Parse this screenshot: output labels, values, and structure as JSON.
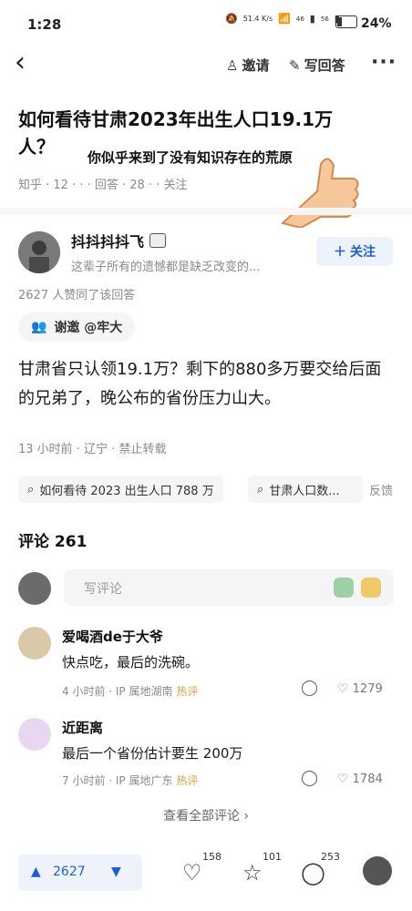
{
  "status_bar": {
    "time": "1:28",
    "net_speed": "51.4 K/s",
    "signal_a": "46",
    "signal_b": "56",
    "battery": "24%"
  },
  "nav": {
    "invite": "邀请",
    "write_answer": "写回答"
  },
  "question": {
    "title": "如何看待甘肃2023年出生人口19.1万人？",
    "meta": "知乎 · 12 · · · 回答 · 28 · · 关注"
  },
  "overlay_caption": "你似乎来到了没有知识存在的荒原",
  "answer": {
    "author": "抖抖抖抖飞",
    "bio": "这辈子所有的遗憾都是缺乏改变的...",
    "follow_label": "关注",
    "likes_line": "2627 人赞同了该回答",
    "thanks": "谢邀 @牢大",
    "body": "甘肃省只认领19.1万？剩下的880多万要交给后面的兄弟了，晚公布的省份压力山大。",
    "meta": "13 小时前 · 辽宁 · 禁止转载"
  },
  "related": {
    "chips": [
      "如何看待 2023 出生人口 788 万",
      "甘肃人口数..."
    ],
    "feedback": "反馈"
  },
  "comments": {
    "header": "评论 261",
    "placeholder": "写评论",
    "items": [
      {
        "name": "爱喝酒de于大爷",
        "text": "快点吃，最后的洗碗。",
        "meta": "4 小时前 · IP 属地湖南",
        "hot": "热评",
        "likes": "1279"
      },
      {
        "name": "近距离",
        "text": "最后一个省份估计要生 200万",
        "meta": "7 小时前 · IP 属地广东",
        "hot": "热评",
        "likes": "1784"
      }
    ],
    "view_all": "查看全部评论"
  },
  "bottom_bar": {
    "votes": "2627",
    "likes": "158",
    "favorites": "101",
    "comments": "253"
  }
}
